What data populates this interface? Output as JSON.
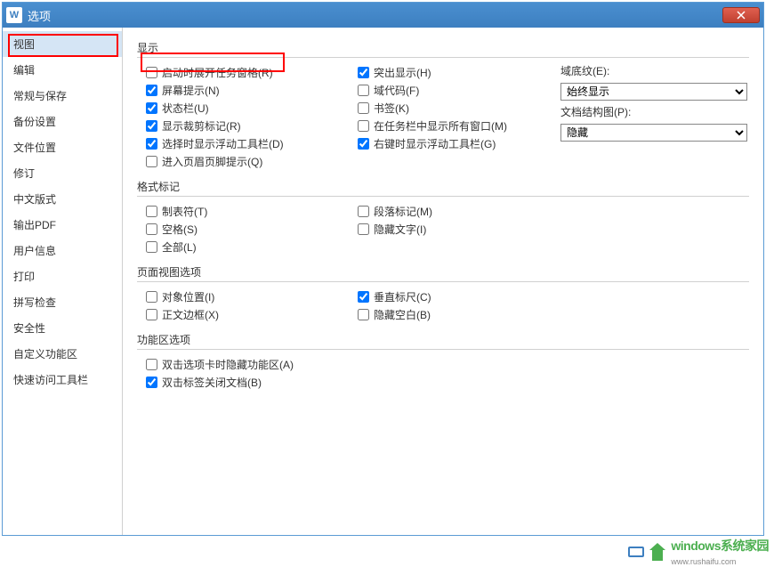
{
  "titlebar": {
    "title": "选项",
    "app_icon": "W"
  },
  "sidebar": {
    "items": [
      "视图",
      "编辑",
      "常规与保存",
      "备份设置",
      "文件位置",
      "修订",
      "中文版式",
      "输出PDF",
      "用户信息",
      "打印",
      "拼写检查",
      "安全性",
      "自定义功能区",
      "快速访问工具栏"
    ]
  },
  "sections": {
    "display": {
      "title": "显示",
      "col1": [
        {
          "label": "启动时展开任务窗格(R)",
          "checked": false
        },
        {
          "label": "屏幕提示(N)",
          "checked": true
        },
        {
          "label": "状态栏(U)",
          "checked": true
        },
        {
          "label": "显示裁剪标记(R)",
          "checked": true
        },
        {
          "label": "选择时显示浮动工具栏(D)",
          "checked": true
        },
        {
          "label": "进入页眉页脚提示(Q)",
          "checked": false
        }
      ],
      "col2": [
        {
          "label": "突出显示(H)",
          "checked": true
        },
        {
          "label": "域代码(F)",
          "checked": false
        },
        {
          "label": "书签(K)",
          "checked": false
        },
        {
          "label": "在任务栏中显示所有窗口(M)",
          "checked": false
        },
        {
          "label": "右键时显示浮动工具栏(G)",
          "checked": true
        }
      ],
      "right": {
        "shading_label": "域底纹(E):",
        "shading_value": "始终显示",
        "docmap_label": "文档结构图(P):",
        "docmap_value": "隐藏"
      }
    },
    "format": {
      "title": "格式标记",
      "col1": [
        {
          "label": "制表符(T)",
          "checked": false
        },
        {
          "label": "空格(S)",
          "checked": false
        },
        {
          "label": "全部(L)",
          "checked": false
        }
      ],
      "col2": [
        {
          "label": "段落标记(M)",
          "checked": false
        },
        {
          "label": "隐藏文字(I)",
          "checked": false
        }
      ]
    },
    "pageview": {
      "title": "页面视图选项",
      "col1": [
        {
          "label": "对象位置(I)",
          "checked": false
        },
        {
          "label": "正文边框(X)",
          "checked": false
        }
      ],
      "col2": [
        {
          "label": "垂直标尺(C)",
          "checked": true
        },
        {
          "label": "隐藏空白(B)",
          "checked": false
        }
      ]
    },
    "ribbon": {
      "title": "功能区选项",
      "col1": [
        {
          "label": "双击选项卡时隐藏功能区(A)",
          "checked": false
        },
        {
          "label": "双击标签关闭文档(B)",
          "checked": true
        }
      ]
    }
  },
  "watermark": {
    "text": "windows系统家园",
    "sub": "www.rushaifu.com"
  }
}
